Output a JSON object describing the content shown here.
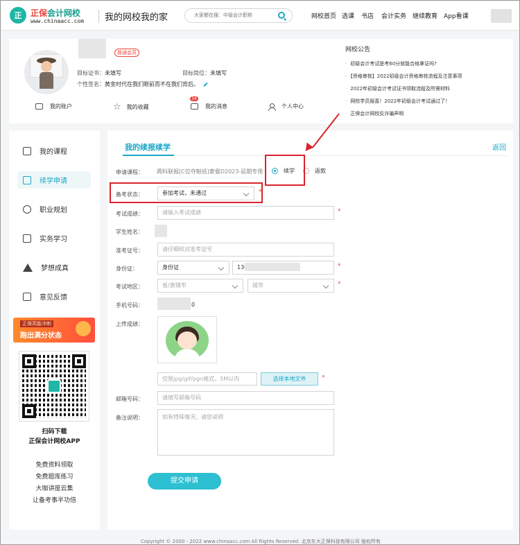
{
  "header": {
    "logo_mark": "正",
    "logo_name_a": "正保",
    "logo_name_b": "会计网校",
    "logo_url": "www.chinaacc.com",
    "slogan": "我的网校我的家",
    "search_placeholder": "大家都在搜：中级会计职称",
    "nav": [
      "网校首页",
      "选课",
      "书店",
      "会计实务",
      "继续教育",
      "App看课"
    ]
  },
  "profile": {
    "member_tag": "普通会员",
    "target_cert_label": "目标证书：",
    "target_cert_value": "未填写",
    "target_job_label": "目标岗位：",
    "target_job_value": "未填写",
    "signature_label": "个性签名：",
    "signature_value": "黄金时代在我们眼前而不在我们背后。",
    "quick_links": {
      "account": "我的账户",
      "favorites": "我的收藏",
      "messages": "我的消息",
      "messages_badge": "34",
      "center": "个人中心"
    }
  },
  "notice": {
    "title": "网校公告",
    "items": [
      "初级会计考试是考60分就能合格拿证吗?",
      "【资格审核】2022初级会计资格审核流程及注意事项",
      "2022年初级会计考试证书领取流程及所需材料",
      "网校学员报喜！2022年初级会计考试通过了！",
      "正保会计网校反诈骗声明"
    ]
  },
  "sidebar": {
    "items": [
      {
        "label": "我的课程",
        "icon": "book-icon"
      },
      {
        "label": "续学申请",
        "icon": "file-icon"
      },
      {
        "label": "职业规划",
        "icon": "career-icon"
      },
      {
        "label": "实务学习",
        "icon": "practice-icon"
      },
      {
        "label": "梦想成真",
        "icon": "send-icon"
      },
      {
        "label": "意见反馈",
        "icon": "mail-icon"
      }
    ],
    "banner_top": "正保高能冲刺",
    "banner_main": "跑出满分状态",
    "qr_title": "扫码下载",
    "qr_subtitle": "正保会计网校APP",
    "links": [
      "免费资料领取",
      "免费题库练习",
      "大咖讲座云集",
      "让备考事半功倍"
    ]
  },
  "form": {
    "tab": "我的续报续学",
    "back": "返回",
    "course_label": "申请课程：",
    "course_value": "两科联报[C位夺魁班]套餐D2023-延期专用",
    "option_continue": "续学",
    "option_refund": "返款",
    "status_label": "备考状态：",
    "status_value": "参加考试，未通过",
    "score_label": "考试成绩：",
    "score_placeholder": "请输入考试成绩",
    "name_label": "学生姓名：",
    "ticket_label": "准考证号：",
    "ticket_placeholder": "请仔细核对准考证号",
    "id_label": "身份证：",
    "id_type": "身份证",
    "id_value_prefix": "130",
    "area_label": "考试地区：",
    "province_placeholder": "省/直辖市",
    "city_placeholder": "城市",
    "phone_label": "手机号码：",
    "phone_suffix": "0",
    "upload_label": "上传成绩：",
    "file_hint": "仅限jpg/gif/pgn格式，5M以内",
    "file_button": "选择本地文件",
    "email_label": "邮箱号码：",
    "email_placeholder": "请填写邮箱号码",
    "remark_label": "备注说明：",
    "remark_placeholder": "如有特殊情况，请您说明",
    "submit": "提交申请"
  },
  "footer": "Copyright © 2000 - 2022 www.chinaacc.com All Rights Reserved. 北京东大正保科技有限公司 版权所有",
  "colors": {
    "accent": "#1aa6c8",
    "brand": "#1fb6a6",
    "annotation": "#d9232b"
  }
}
